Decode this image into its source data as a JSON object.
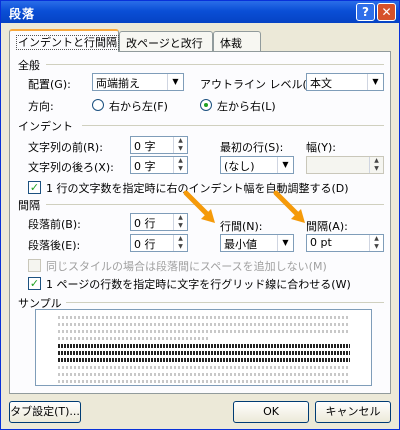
{
  "window": {
    "title": "段落"
  },
  "tabs": [
    {
      "label": "インデントと行間隔"
    },
    {
      "label": "改ページと改行"
    },
    {
      "label": "体裁"
    }
  ],
  "general": {
    "section": "全般",
    "alignment_label": "配置(G):",
    "alignment_value": "両端揃え",
    "outline_label": "アウトライン レベル(O):",
    "outline_value": "本文",
    "direction_label": "方向:",
    "rtl_label": "右から左(F)",
    "ltr_label": "左から右(L)",
    "direction_selected": "ltr"
  },
  "indent": {
    "section": "インデント",
    "before_label": "文字列の前(R):",
    "before_value": "0 字",
    "after_label": "文字列の後ろ(X):",
    "after_value": "0 字",
    "first_line_label": "最初の行(S):",
    "first_line_value": "(なし)",
    "width_label": "幅(Y):",
    "width_value": "",
    "auto_adjust_label": "1 行の文字数を指定時に右のインデント幅を自動調整する(D)",
    "auto_adjust_checked": true
  },
  "spacing": {
    "section": "間隔",
    "before_label": "段落前(B):",
    "before_value": "0 行",
    "after_label": "段落後(E):",
    "after_value": "0 行",
    "line_label": "行間(N):",
    "line_value": "最小値",
    "at_label": "間隔(A):",
    "at_value": "0 pt",
    "same_style_label": "同じスタイルの場合は段落間にスペースを追加しない(M)",
    "same_style_checked": false,
    "grid_label": "1 ページの行数を指定時に文字を行グリッド線に合わせる(W)",
    "grid_checked": true
  },
  "sample": {
    "section": "サンプル"
  },
  "buttons": {
    "tab_settings": "タブ設定(T)...",
    "ok": "OK",
    "cancel": "キャンセル"
  },
  "colors": {
    "annotation_arrow": "#f59a0a",
    "titlebar": "#0a4fd6"
  }
}
